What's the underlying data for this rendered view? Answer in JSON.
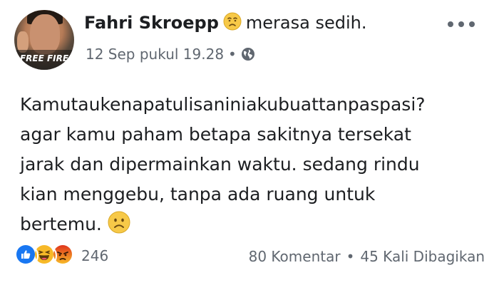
{
  "post": {
    "author": "Fahri Skroepp",
    "feeling": "merasa sedih.",
    "timestamp": "12 Sep pukul 19.28",
    "meta_separator": "•",
    "avatar_logo_text": "FREE FIRE",
    "text_lines": [
      "Kamutaukenapatulisaniniakubuattanpaspasi?",
      "agar kamu paham betapa sakitnya tersekat",
      "jarak dan dipermainkan waktu. sedang rindu",
      "kian menggebu, tanpa ada ruang untuk",
      "bertemu."
    ]
  },
  "reactions": {
    "icons": [
      "like-icon",
      "haha-icon",
      "angry-icon"
    ],
    "count": "246"
  },
  "stats": {
    "comments": "80 Komentar",
    "separator": "•",
    "shares": "45 Kali Dibagikan"
  },
  "icons": {
    "feeling": "sad-face-icon",
    "privacy": "globe-icon",
    "more": "more-options-icon",
    "text_emoji": "frowning-face-icon"
  },
  "colors": {
    "like": "#1877f2",
    "haha": "#f7b928",
    "angry": "#e9710f",
    "secondary_text": "#606770"
  }
}
